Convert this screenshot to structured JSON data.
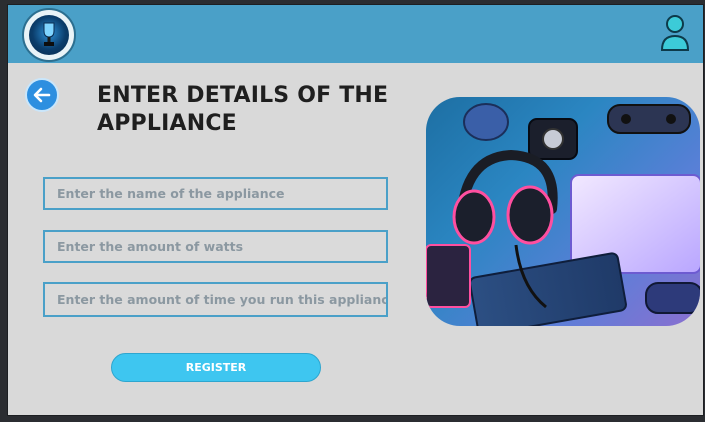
{
  "header": {
    "logo": "logo-emblem",
    "user_icon": "user-icon"
  },
  "page": {
    "back_icon": "arrow-left-icon",
    "title_line1": "ENTER DETAILS OF THE",
    "title_line2": "APPLIANCE"
  },
  "form": {
    "name_placeholder": "Enter the name of the appliance",
    "watts_placeholder": "Enter the amount of watts",
    "time_placeholder": "Enter the amount of time you run this appliance",
    "register_label": "REGISTER"
  },
  "image": {
    "subject": "electronic devices: headphones, laptop, keyboard, controllers"
  },
  "colors": {
    "header": "#4aa0c8",
    "background": "#d9d9d9",
    "button": "#3ec6f0",
    "back_button": "#2d8fe0"
  }
}
